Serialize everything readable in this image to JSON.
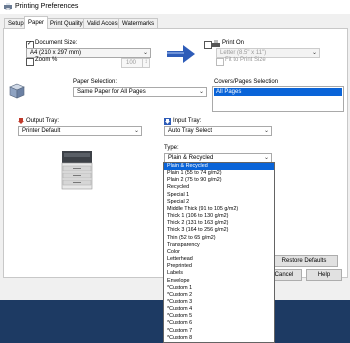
{
  "window": {
    "title": "Printing Preferences"
  },
  "tabs": [
    {
      "label": "Setup"
    },
    {
      "label": "Paper"
    },
    {
      "label": "Print Quality"
    },
    {
      "label": "Valid Access"
    },
    {
      "label": "Watermarks"
    }
  ],
  "document_size": {
    "label": "Document Size:",
    "value": "A4 (210 x 297 mm)",
    "checked": true
  },
  "zoom": {
    "label": "Zoom %",
    "value": "100",
    "checked": false
  },
  "print_on": {
    "label": "Print On",
    "value": "Letter (8.5\" x 11\")",
    "checked": false
  },
  "fit_to_print_size": {
    "label": "Fit to Print Size"
  },
  "paper_selection": {
    "label": "Paper Selection:",
    "value": "Same Paper for All Pages"
  },
  "covers_pages_selection": {
    "label": "Covers/Pages Selection",
    "items": [
      "All Pages"
    ]
  },
  "output_tray": {
    "label": "Output Tray:",
    "value": "Printer Default"
  },
  "input_tray": {
    "label": "Input Tray:",
    "value": "Auto Tray Select"
  },
  "type": {
    "label": "Type:",
    "value": "Plain & Recycled",
    "options": [
      "Plain & Recycled",
      "Plain 1 (55 to 74 g/m2)",
      "Plain 2 (75 to 90 g/m2)",
      "Recycled",
      "Special 1",
      "Special 2",
      "Middle Thick (91 to 105 g/m2)",
      "Thick 1 (106 to 130 g/m2)",
      "Thick 2 (131 to 163 g/m2)",
      "Thick 3 (164 to 256 g/m2)",
      "Thin (52 to 65 g/m2)",
      "Transparency",
      "Color",
      "Letterhead",
      "Preprinted",
      "Labels",
      "Envelope",
      "*Custom 1",
      "*Custom 2",
      "*Custom 3",
      "*Custom 4",
      "*Custom 5",
      "*Custom 6",
      "*Custom 7",
      "*Custom 8"
    ]
  },
  "buttons": {
    "restore_defaults": "Restore Defaults",
    "cancel": "Cancel",
    "help": "Help"
  },
  "colors": {
    "accent": "#0a64d8",
    "taskbar": "#1d3a63",
    "icon_red": "#c0392b",
    "icon_blue": "#2e5cb8"
  }
}
